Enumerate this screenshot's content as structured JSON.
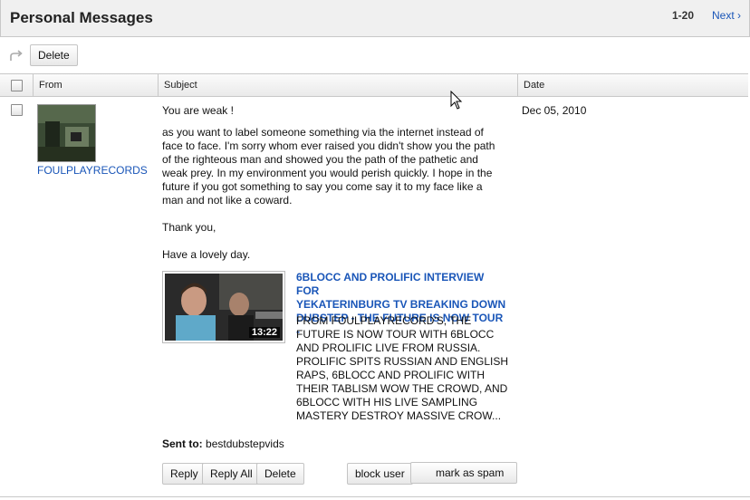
{
  "header": {
    "title": "Personal Messages",
    "range": "1-20",
    "next_label": "Next ›"
  },
  "toolbar": {
    "reply_icon": "reply-arrow-icon",
    "delete_label": "Delete"
  },
  "columns": {
    "from": "From",
    "subject": "Subject",
    "date": "Date"
  },
  "message": {
    "sender": "FOULPLAYRECORDS",
    "subject": "You are weak !",
    "date": "Dec 05, 2010",
    "body_lines": [
      "as you want to label someone something via the internet instead of",
      "face to face. I'm sorry whom ever raised you didn't show you the path",
      "of the righteous man and showed you the path of the pathetic and",
      "weak prey. In my environment you would perish quickly. I hope in the",
      "future if you got something to say you come say it to my face like a",
      "man and not like a coward."
    ],
    "thanks": "Thank you,",
    "closing": "Have a lovely day.",
    "video": {
      "duration": "13:22",
      "title_lines": [
        "6BLOCC AND PROLIFIC INTERVIEW FOR",
        "YEKATERINBURG TV BREAKING DOWN",
        "DUBSTEP - THE FUTURE IS NOW TOUR -"
      ],
      "desc_lines": [
        "FROM FOULPLAYRECORD'S, THE",
        "FUTURE IS NOW TOUR WITH 6BLOCC",
        "AND PROLIFIC LIVE FROM RUSSIA.",
        "PROLIFIC SPITS RUSSIAN AND ENGLISH",
        "RAPS, 6BLOCC AND PROLIFIC WITH",
        "THEIR TABLISM WOW THE CROWD, AND",
        "6BLOCC WITH HIS LIVE SAMPLING",
        "MASTERY DESTROY MASSIVE CROW..."
      ]
    },
    "sent_to_label": "Sent to:",
    "sent_to_value": "bestdubstepvids"
  },
  "actions": {
    "reply": "Reply",
    "reply_all": "Reply All",
    "delete": "Delete",
    "block_user": "block user",
    "mark_spam": "mark as spam"
  },
  "colors": {
    "link": "#1a56b8",
    "header_bg": "#f0f0f0",
    "border": "#c8c8c8"
  }
}
